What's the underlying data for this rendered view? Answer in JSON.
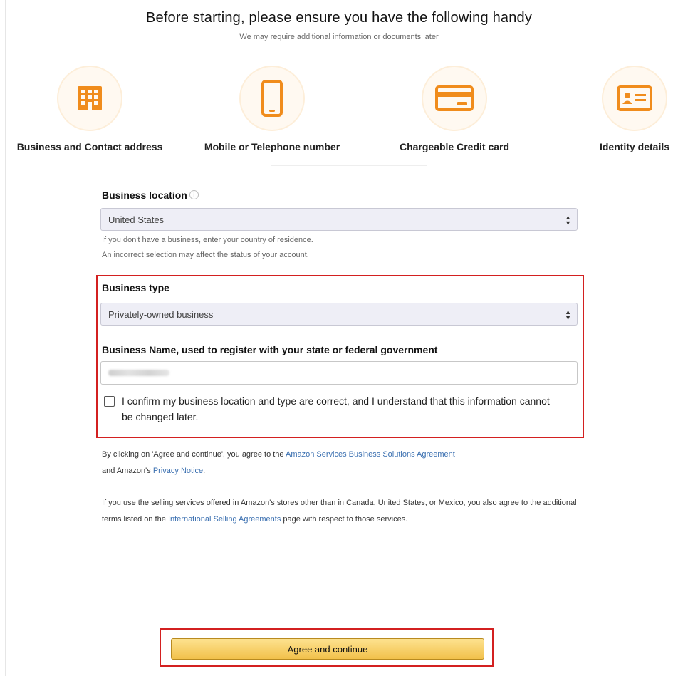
{
  "header": {
    "title": "Before starting, please ensure you have the following handy",
    "subtitle": "We may require additional information or documents later"
  },
  "requirements": [
    {
      "label": "Business and Contact address",
      "icon": "building-icon"
    },
    {
      "label": "Mobile or Telephone number",
      "icon": "mobile-phone-icon"
    },
    {
      "label": "Chargeable Credit card",
      "icon": "credit-card-icon"
    },
    {
      "label": "Identity details",
      "icon": "id-card-icon"
    }
  ],
  "accent_color": "#f08c1c",
  "highlight_color": "#d32020",
  "form": {
    "location_label": "Business location",
    "location_value": "United States",
    "location_hint_1": "If you don't have a business, enter your country of residence.",
    "location_hint_2": "An incorrect selection may affect the status of your account.",
    "type_label": "Business type",
    "type_value": "Privately-owned business",
    "name_label": "Business Name, used to register with your state or federal government",
    "confirm_text": "I confirm my business location and type are correct, and I understand that this information cannot be changed later."
  },
  "legal": {
    "p1_text": "By clicking on 'Agree and continue', you agree to the",
    "p1_link": "Amazon Services Business Solutions Agreement",
    "p1_and": "and Amazon's",
    "p1_link2": "Privacy Notice",
    "p2_text": "If you use the selling services offered in Amazon's stores other than in Canada, United States, or Mexico, you also agree to the additional terms listed on the",
    "p2_link": "International Selling Agreements",
    "p2_after": "page with respect to those services."
  },
  "button": {
    "agree_label": "Agree and continue"
  }
}
